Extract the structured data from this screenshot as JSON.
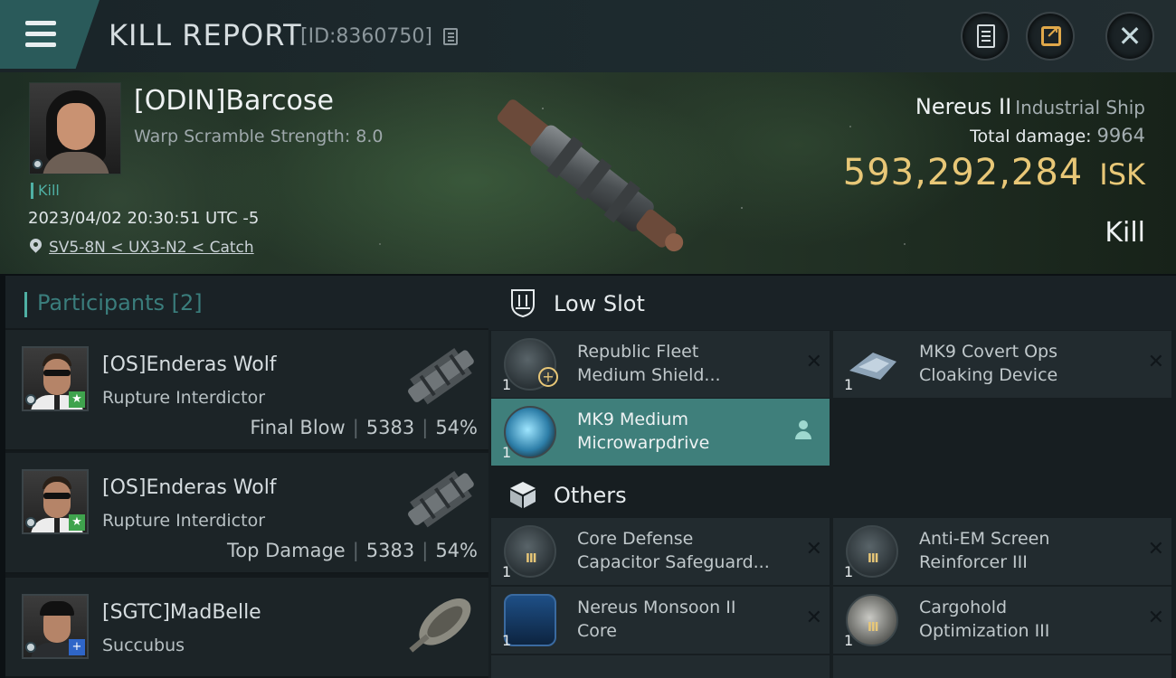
{
  "header": {
    "title": "KILL REPORT",
    "report_id": "[ID:8360750]"
  },
  "victim": {
    "pilot": "[ODIN]Barcose",
    "scramble": "Warp Scramble Strength: 8.0",
    "tag": "Kill",
    "timestamp": "2023/04/02 20:30:51 UTC -5",
    "location": "SV5-8N < UX3-N2 < Catch",
    "ship_name": "Nereus II",
    "ship_class": "Industrial Ship",
    "damage_label": "Total damage:",
    "damage_value": "9964",
    "isk_value": "593,292,284",
    "isk_unit": "ISK",
    "report_type": "Kill"
  },
  "participants": {
    "label": "Participants",
    "count": "[2]",
    "rows": [
      {
        "name": "[OS]Enderas Wolf",
        "ship": "Rupture Interdictor",
        "role": "Final Blow",
        "damage": "5383",
        "percent": "54%"
      },
      {
        "name": "[OS]Enderas Wolf",
        "ship": "Rupture Interdictor",
        "role": "Top Damage",
        "damage": "5383",
        "percent": "54%"
      },
      {
        "name": "[SGTC]MadBelle",
        "ship": "Succubus"
      }
    ]
  },
  "sections": {
    "low_slot": "Low Slot",
    "others": "Others"
  },
  "modules": {
    "low": [
      {
        "qty": "1",
        "line1": "Republic Fleet",
        "line2": "Medium Shield..."
      },
      {
        "qty": "1",
        "line1": "MK9 Covert Ops",
        "line2": "Cloaking Device"
      },
      {
        "qty": "1",
        "line1": "MK9 Medium",
        "line2": "Microwarpdrive"
      }
    ],
    "others": [
      {
        "qty": "1",
        "line1": "Core Defense",
        "line2": "Capacitor Safeguard..."
      },
      {
        "qty": "1",
        "line1": "Anti-EM Screen",
        "line2": "Reinforcer III"
      },
      {
        "qty": "1",
        "line1": "Nereus Monsoon II",
        "line2": "Core"
      },
      {
        "qty": "1",
        "line1": "Cargohold",
        "line2": "Optimization III"
      }
    ]
  },
  "colors": {
    "accent": "#4fb0a4",
    "isk_gold": "#e8c777",
    "active_module": "#3f7f7b"
  }
}
